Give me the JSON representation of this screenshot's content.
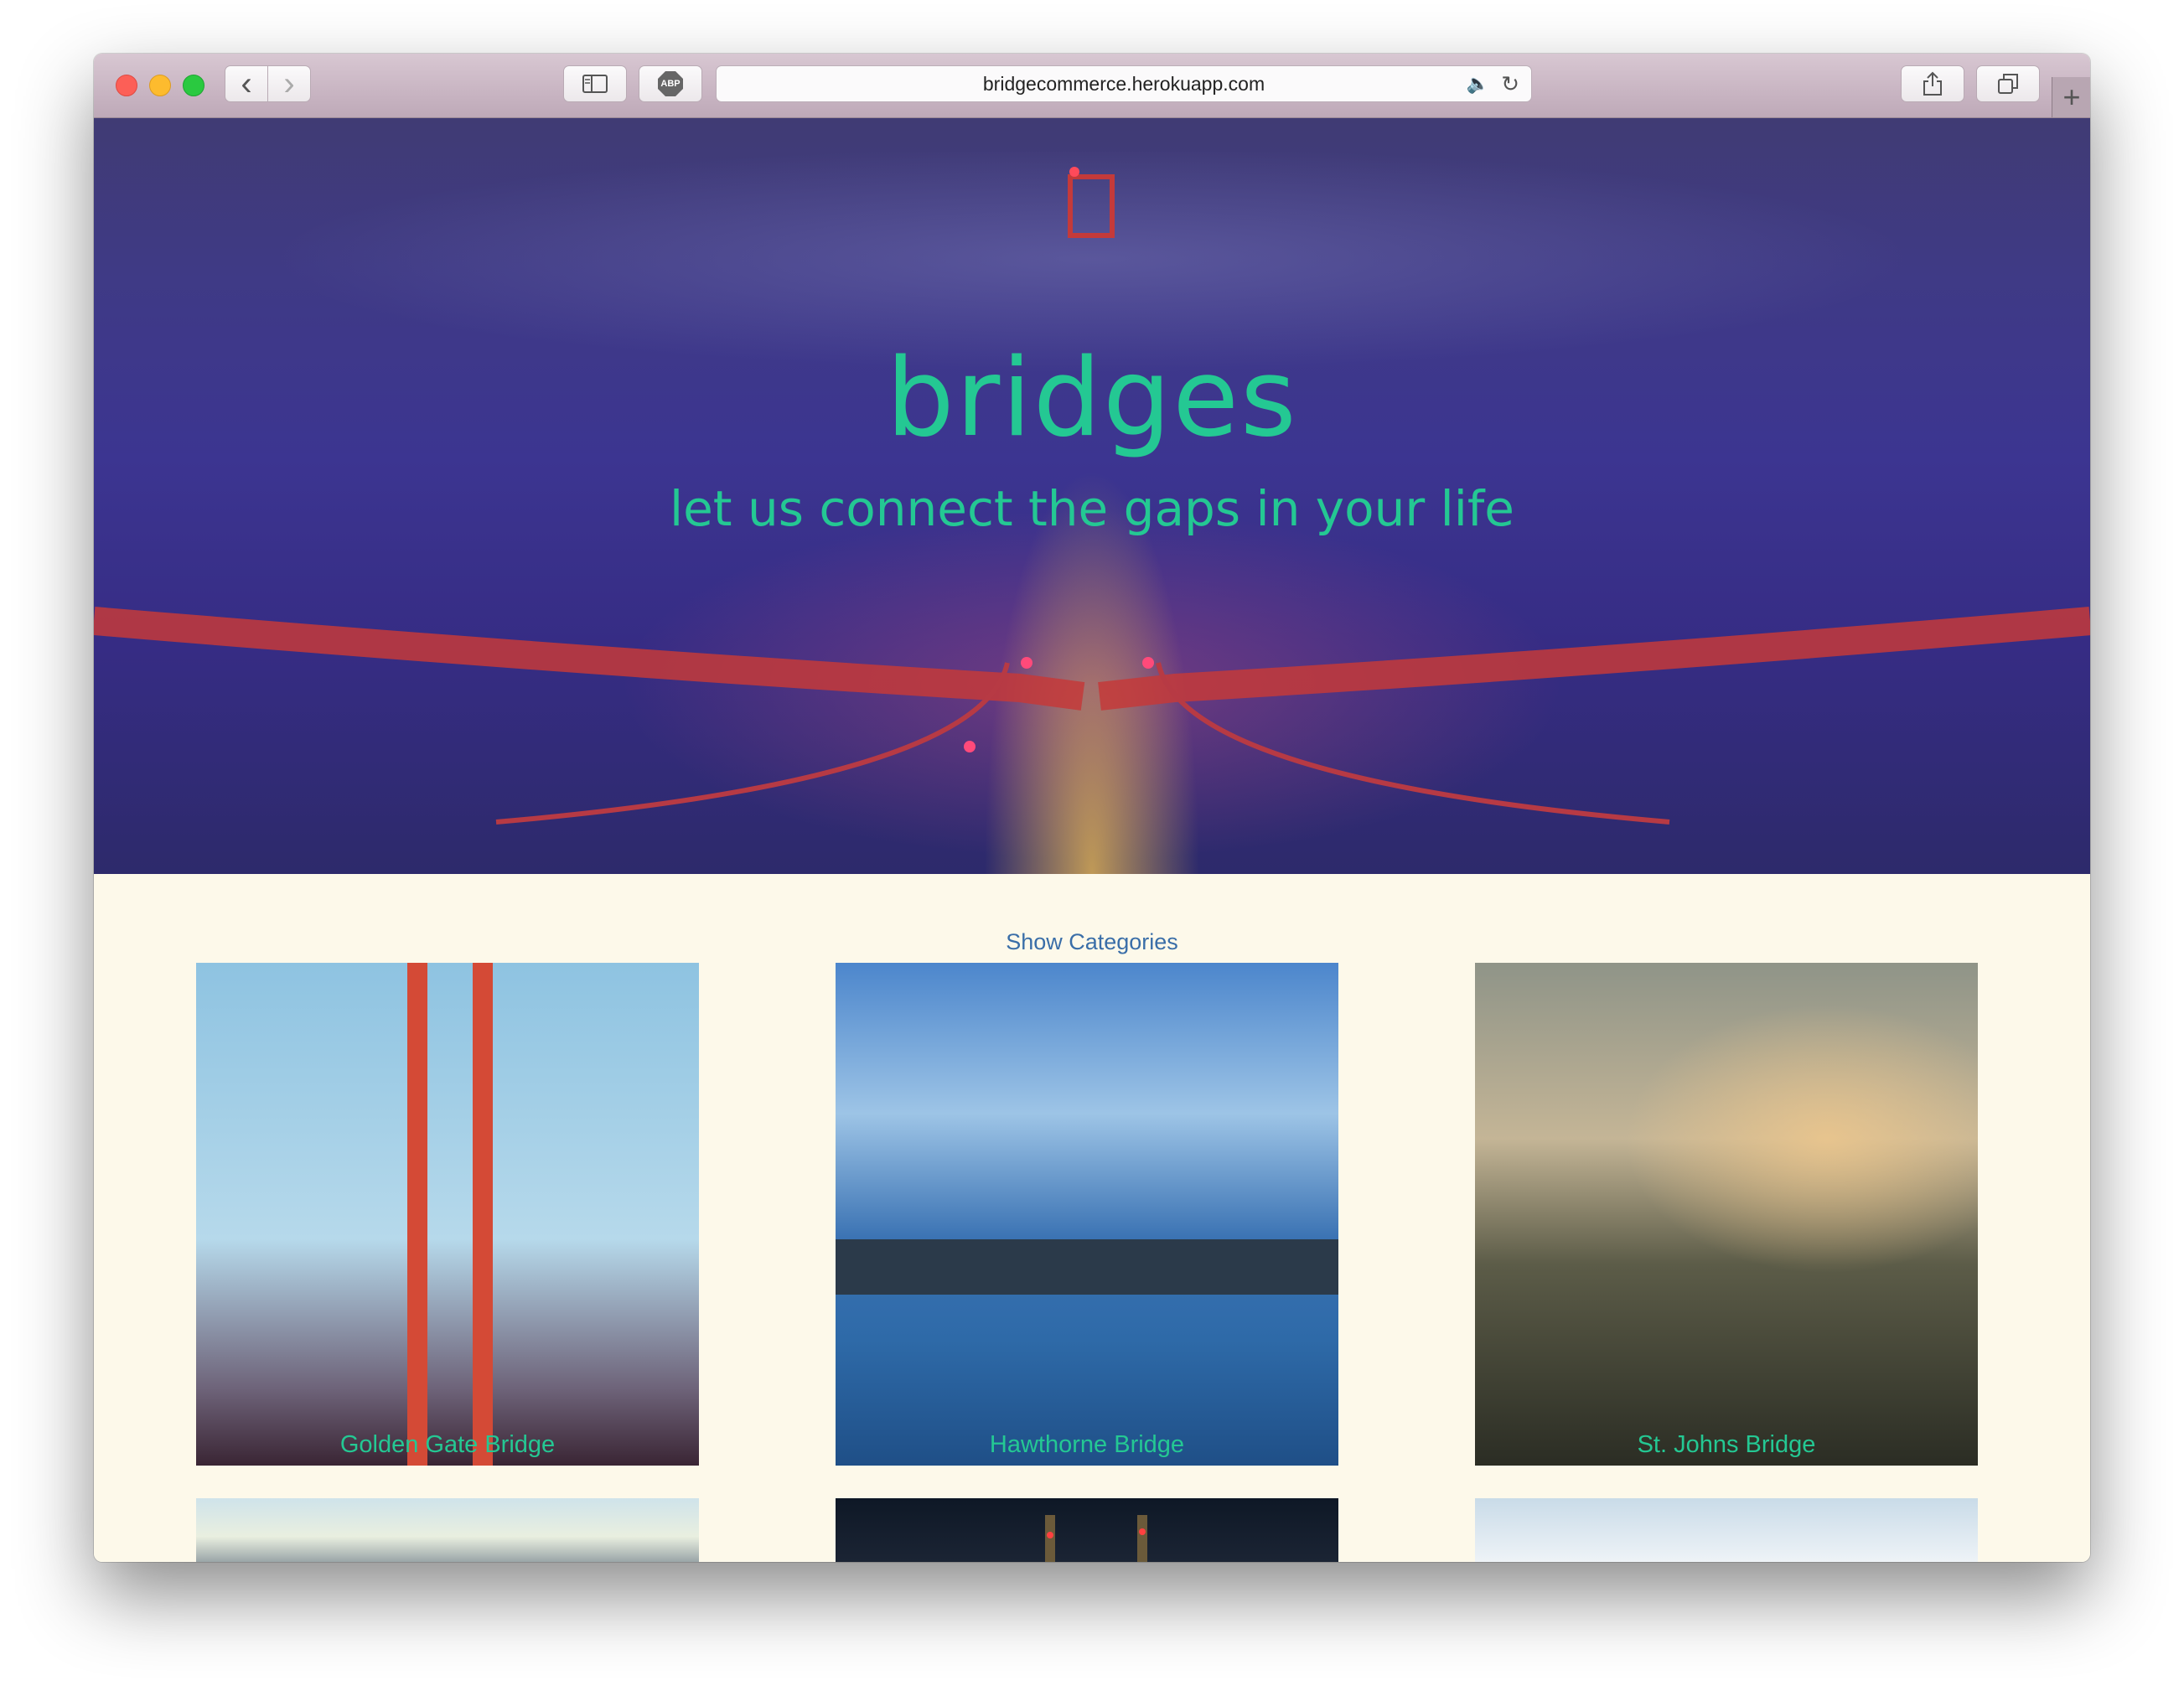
{
  "browser": {
    "url": "bridgecommerce.herokuapp.com",
    "buttons": {
      "back": "‹",
      "forward": "›",
      "abp": "ABP",
      "new_tab": "+"
    }
  },
  "hero": {
    "title": "bridges",
    "subtitle": "let us connect the gaps in your life"
  },
  "categories_toggle": "Show Categories",
  "products": [
    {
      "caption": "Golden Gate Bridge"
    },
    {
      "caption": "Hawthorne Bridge"
    },
    {
      "caption": "St. Johns Bridge"
    }
  ],
  "colors": {
    "accent": "#24c893",
    "link": "#3a6ea8",
    "page_background": "#fdf9ea"
  }
}
